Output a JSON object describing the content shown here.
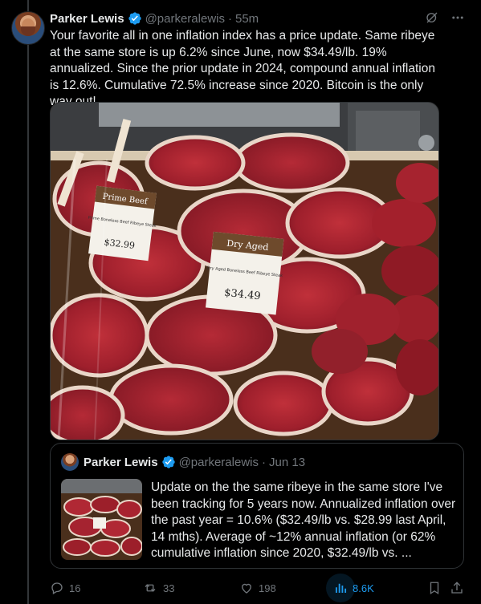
{
  "tweet": {
    "author_name": "Parker Lewis",
    "handle": "@parkeralewis",
    "separator": "·",
    "time": "55m",
    "text": "Your favorite all in one inflation index has a price update. Same ribeye at the same store is up 6.2% since June, now $34.49/lb. 19% annualized. Since the prior update in 2024, compound annual inflation is 12.6%. Cumulative 72.5% increase since 2020. Bitcoin is the only way out!",
    "media": {
      "sign1_title": "Prime Beef",
      "sign1_line": "Prime Boneless Beef Ribeye Steak",
      "sign1_price": "$32.99",
      "sign2_title": "Dry Aged",
      "sign2_line": "Dry Aged Boneless Beef Ribeye Steak",
      "sign2_price": "$34.49"
    }
  },
  "quote": {
    "author_name": "Parker Lewis",
    "handle": "@parkeralewis",
    "separator": "·",
    "date": "Jun 13",
    "text": "Update on the the same ribeye in the same store I've been tracking for 5 years now. Annualized inflation over the past year = 10.6% ($32.49/lb vs. $28.99 last April, 14 mths). Average of ~12% annual inflation (or 62% cumulative inflation since 2020, $32.49/lb vs. ..."
  },
  "actions": {
    "replies": "16",
    "reposts": "33",
    "likes": "198",
    "views": "8.6K"
  },
  "icons": {
    "verified": "verified-badge-icon",
    "grok": "grok-icon",
    "more": "more-icon",
    "reply": "reply-icon",
    "repost": "repost-icon",
    "like": "like-icon",
    "views": "views-icon",
    "bookmark": "bookmark-icon",
    "share": "share-icon"
  },
  "colors": {
    "background": "#000000",
    "text": "#e7e9ea",
    "muted": "#71767b",
    "accent": "#1d9bf0",
    "border": "#2f3336"
  }
}
